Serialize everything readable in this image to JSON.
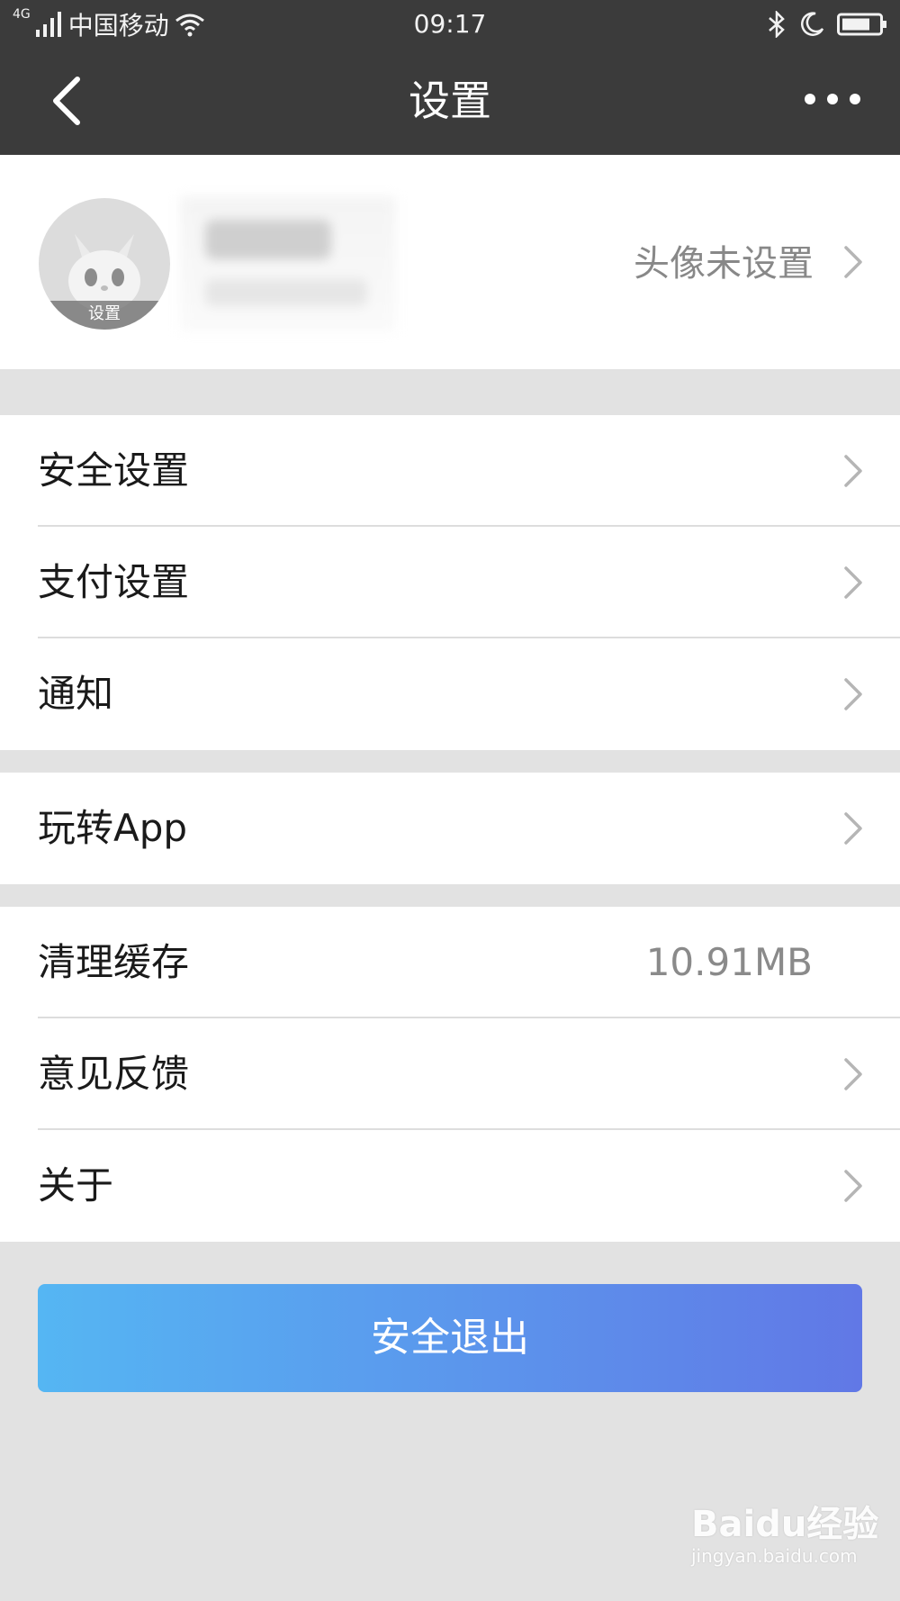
{
  "status_bar": {
    "network": "4G",
    "carrier": "中国移动",
    "time": "09:17",
    "icons": [
      "signal-icon",
      "wifi-icon",
      "bluetooth-icon",
      "moon-icon",
      "battery-icon"
    ]
  },
  "nav": {
    "title": "设置",
    "back_icon": "chevron-left-icon",
    "more_icon": "more-dots-icon"
  },
  "profile": {
    "avatar_caption": "设置",
    "hint": "头像未设置"
  },
  "groups": [
    [
      {
        "label": "安全设置",
        "chevron": true
      },
      {
        "label": "支付设置",
        "chevron": true
      },
      {
        "label": "通知",
        "chevron": true
      }
    ],
    [
      {
        "label": "玩转App",
        "chevron": true
      }
    ],
    [
      {
        "label": "清理缓存",
        "value": "10.91MB",
        "chevron": false
      },
      {
        "label": "意见反馈",
        "chevron": true
      },
      {
        "label": "关于",
        "chevron": true
      }
    ]
  ],
  "logout": {
    "label": "安全退出"
  },
  "watermark": {
    "main": "Baidu经验",
    "sub": "jingyan.baidu.com"
  },
  "colors": {
    "header_bg": "#3b3b3b",
    "page_bg": "#e2e2e2",
    "button_start": "#55b6f3",
    "button_end": "#6178e6"
  }
}
